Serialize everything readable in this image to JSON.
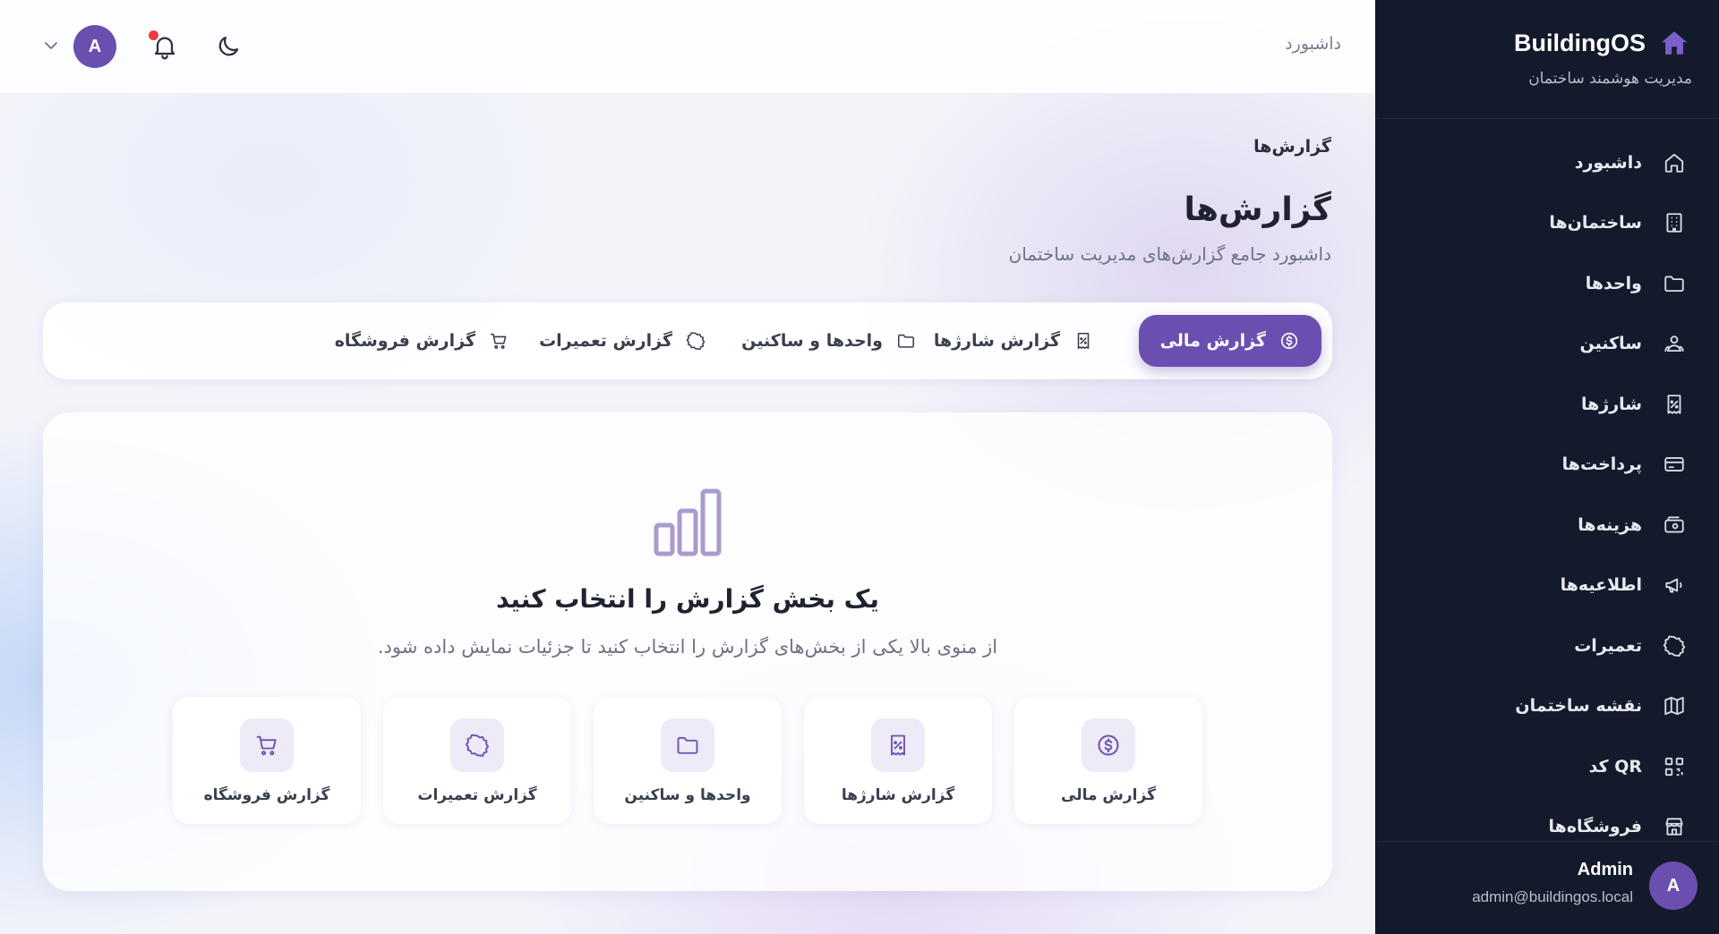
{
  "sidebar": {
    "brand": {
      "title": "BuildingOS",
      "subtitle": "مدیریت هوشمند ساختمان",
      "logo_icon": "home-icon"
    },
    "items": [
      {
        "label": "داشبورد",
        "icon": "home-icon"
      },
      {
        "label": "ساختمان‌ها",
        "icon": "building-icon"
      },
      {
        "label": "واحدها",
        "icon": "folder-icon"
      },
      {
        "label": "ساکنین",
        "icon": "users-icon"
      },
      {
        "label": "شارژها",
        "icon": "receipt-icon"
      },
      {
        "label": "پرداخت‌ها",
        "icon": "credit-card-icon"
      },
      {
        "label": "هزینه‌ها",
        "icon": "wallet-icon"
      },
      {
        "label": "اطلاعیه‌ها",
        "icon": "megaphone-icon"
      },
      {
        "label": "تعمیرات",
        "icon": "badge-icon"
      },
      {
        "label": "نقشه ساختمان",
        "icon": "map-icon"
      },
      {
        "label": "کد QR",
        "icon": "qr-code-icon"
      },
      {
        "label": "فروشگاه‌ها",
        "icon": "store-icon"
      }
    ],
    "user": {
      "avatar": "A",
      "name": "Admin",
      "email": "admin@buildingos.local"
    }
  },
  "topbar": {
    "breadcrumb": "داشبورد",
    "avatar": "A"
  },
  "page": {
    "breadcrumb": "گزارش‌ها",
    "title": "گزارش‌ها",
    "subtitle": "داشبورد جامع گزارش‌های مدیریت ساختمان"
  },
  "tabs": [
    {
      "label": "گزارش مالی",
      "icon": "dollar-circle-icon",
      "active": true
    },
    {
      "label": "گزارش شارژها",
      "icon": "receipt-icon",
      "active": false
    },
    {
      "label": "واحدها و ساکنین",
      "icon": "folder-icon",
      "active": false
    },
    {
      "label": "گزارش تعمیرات",
      "icon": "badge-icon",
      "active": false
    },
    {
      "label": "گزارش فروشگاه",
      "icon": "cart-icon",
      "active": false
    }
  ],
  "empty_state": {
    "icon": "bar-chart-icon",
    "title": "یک بخش گزارش را انتخاب کنید",
    "subtitle": "از منوی بالا یکی از بخش‌های گزارش را انتخاب کنید تا جزئیات نمایش داده شود.",
    "cards": [
      {
        "label": "گزارش مالی",
        "icon": "dollar-circle-icon"
      },
      {
        "label": "گزارش شارژها",
        "icon": "receipt-icon"
      },
      {
        "label": "واحدها و ساکنین",
        "icon": "folder-icon"
      },
      {
        "label": "گزارش تعمیرات",
        "icon": "badge-icon"
      },
      {
        "label": "گزارش فروشگاه",
        "icon": "cart-icon"
      }
    ]
  },
  "colors": {
    "accent": "#6b4fb0",
    "sidebar_bg": "#131a2b",
    "notification_dot": "#ef3b3b"
  }
}
